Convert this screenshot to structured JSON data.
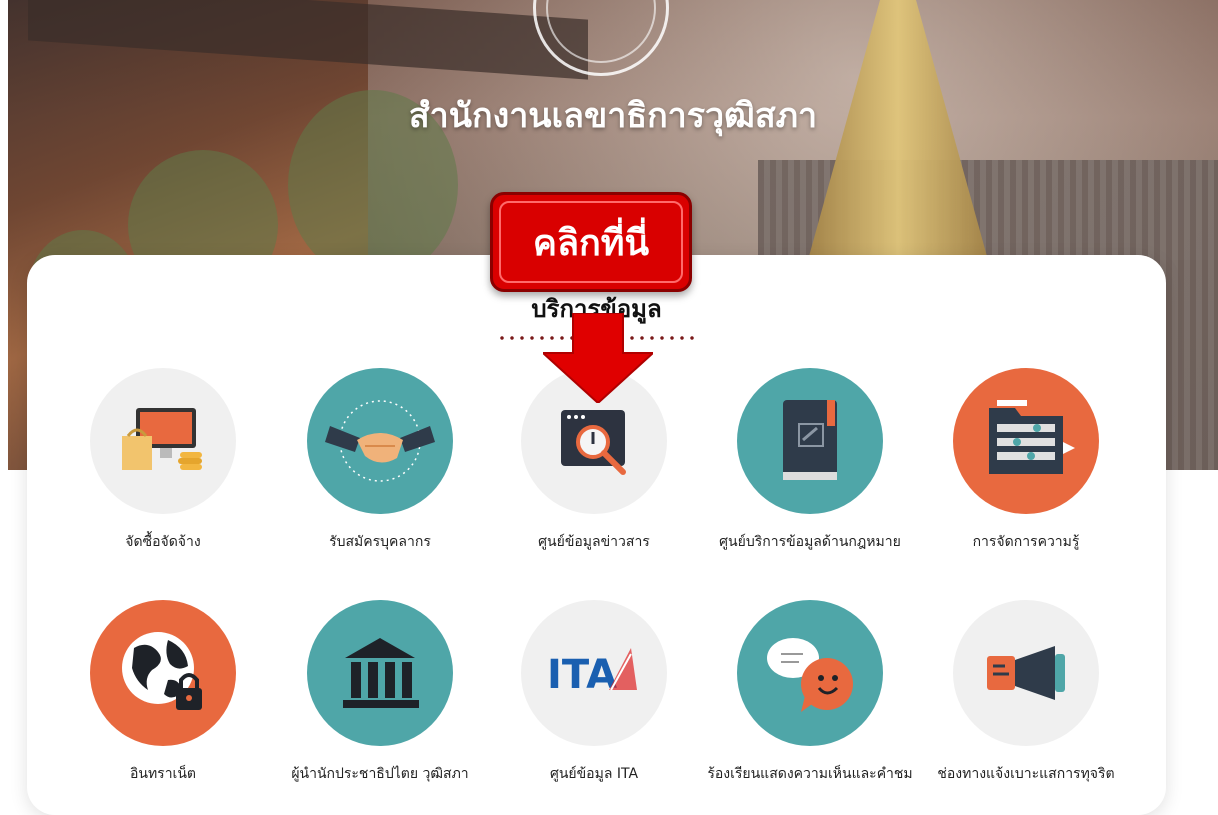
{
  "header": {
    "title": "สำนักงานเลขาธิการวุฒิสภา"
  },
  "callout": {
    "text": "คลิกที่นี่",
    "color": "#d90000"
  },
  "section": {
    "title": "บริการข้อมูล"
  },
  "services": [
    {
      "label": "จัดซื้อจัดจ้าง",
      "icon": "procurement-icon",
      "bg": "#f2f2f2"
    },
    {
      "label": "รับสมัครบุคลากร",
      "icon": "handshake-icon",
      "bg": "#4fa6a8"
    },
    {
      "label": "ศูนย์ข้อมูลข่าวสาร",
      "icon": "search-window-icon",
      "bg": "#f2f2f2"
    },
    {
      "label": "ศูนย์บริการข้อมูลด้านกฎหมาย",
      "icon": "law-book-icon",
      "bg": "#4fa6a8"
    },
    {
      "label": "การจัดการความรู้",
      "icon": "folder-icon",
      "bg": "#e8693f"
    },
    {
      "label": "อินทราเน็ต",
      "icon": "globe-lock-icon",
      "bg": "#e8693f"
    },
    {
      "label": "ผู้นำนักประชาธิปไตย วุฒิสภา",
      "icon": "building-pillars-icon",
      "bg": "#4fa6a8"
    },
    {
      "label": "ศูนย์ข้อมูล ITA",
      "icon": "ita-logo-icon",
      "bg": "#f2f2f2"
    },
    {
      "label": "ร้องเรียนแสดงความเห็นและคำชม",
      "icon": "chat-smile-icon",
      "bg": "#4fa6a8"
    },
    {
      "label": "ช่องทางแจ้งเบาะแสการทุจริต",
      "icon": "megaphone-icon",
      "bg": "#f2f2f2"
    }
  ],
  "ita": {
    "text": "ITA"
  }
}
